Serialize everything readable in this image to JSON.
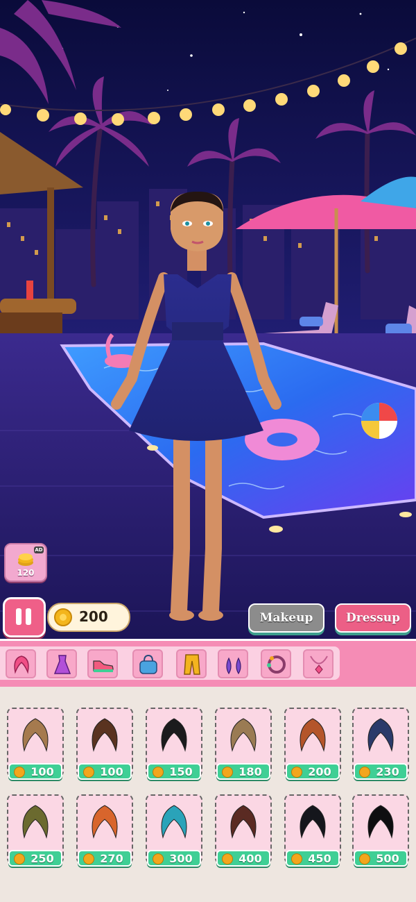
{
  "hud": {
    "ad_badge": "AD",
    "ad_reward": "120",
    "coins": "200",
    "makeup_label": "Makeup",
    "dressup_label": "Dressup"
  },
  "categories": [
    {
      "name": "hair",
      "icon": "hair-icon"
    },
    {
      "name": "dress",
      "icon": "dress-icon"
    },
    {
      "name": "shoes",
      "icon": "sneaker-icon"
    },
    {
      "name": "bag",
      "icon": "handbag-icon"
    },
    {
      "name": "pants",
      "icon": "pants-icon"
    },
    {
      "name": "earrings",
      "icon": "earrings-icon"
    },
    {
      "name": "bracelet",
      "icon": "bracelet-icon"
    },
    {
      "name": "necklace",
      "icon": "necklace-icon"
    }
  ],
  "items": [
    {
      "price": "100",
      "hair_color": "#a57a4e"
    },
    {
      "price": "100",
      "hair_color": "#5a3320"
    },
    {
      "price": "150",
      "hair_color": "#1b1b1d"
    },
    {
      "price": "180",
      "hair_color": "#9a7b53"
    },
    {
      "price": "200",
      "hair_color": "#b4552a"
    },
    {
      "price": "230",
      "hair_color": "#2a3a6a"
    },
    {
      "price": "250",
      "hair_color": "#6b6a2f"
    },
    {
      "price": "270",
      "hair_color": "#d8652c"
    },
    {
      "price": "300",
      "hair_color": "#2aa3b9"
    },
    {
      "price": "400",
      "hair_color": "#5a2a22"
    },
    {
      "price": "450",
      "hair_color": "#15161c"
    },
    {
      "price": "500",
      "hair_color": "#0e0e10"
    }
  ],
  "colors": {
    "accent_pink": "#ec5f86",
    "price_green": "#3fcf95",
    "makeup_gray": "#8c8c8c"
  }
}
